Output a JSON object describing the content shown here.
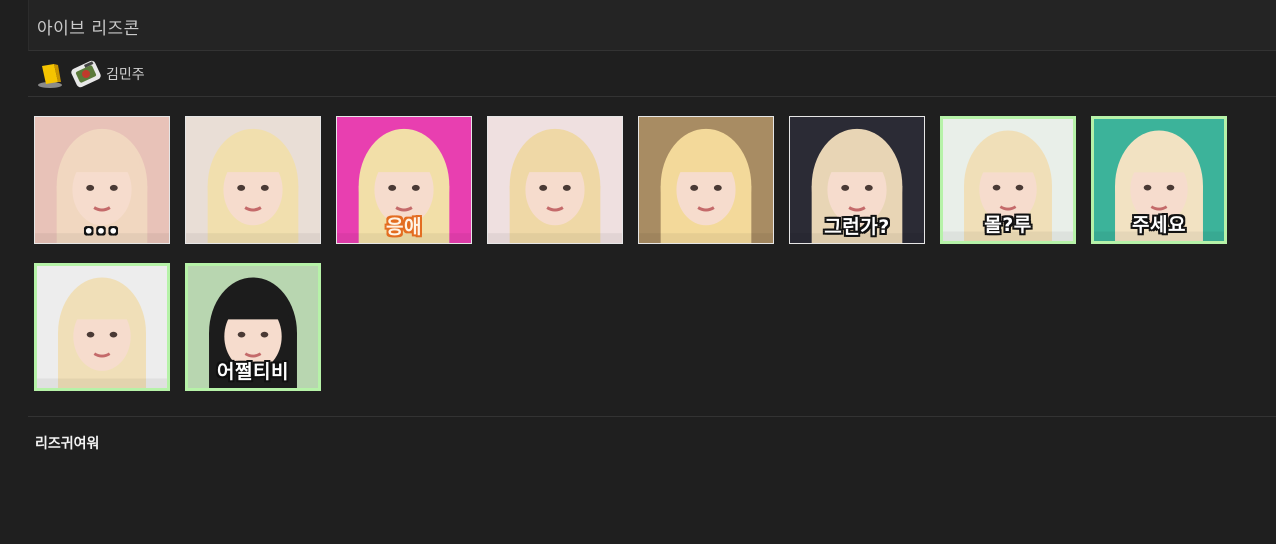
{
  "title": "아이브 리즈콘",
  "author": {
    "name": "김민주",
    "badge_icon": "yellow-trophy-icon",
    "avatar_icon": "tank-avatar-icon"
  },
  "emoticons": [
    {
      "caption": "•••",
      "style": "dots",
      "frame": "plain",
      "bg": "#e8c2b8",
      "hair": "#f1d7c0"
    },
    {
      "caption": "",
      "style": "",
      "frame": "plain",
      "bg": "#e9ded6",
      "hair": "#f1dfae"
    },
    {
      "caption": "응애",
      "style": "orange",
      "frame": "plain",
      "bg": "#e83fb0",
      "hair": "#f2dfa8"
    },
    {
      "caption": "",
      "style": "",
      "frame": "plain",
      "bg": "#efe0e0",
      "hair": "#efd8a6"
    },
    {
      "caption": "",
      "style": "",
      "frame": "plain",
      "bg": "#a88c63",
      "hair": "#f3d99a"
    },
    {
      "caption": "그런가?",
      "style": "",
      "frame": "plain",
      "bg": "#2b2b35",
      "hair": "#e8d5b5"
    },
    {
      "caption": "몰?루",
      "style": "",
      "frame": "green",
      "bg": "#e9efe9",
      "hair": "#f0dfb8"
    },
    {
      "caption": "주세요",
      "style": "",
      "frame": "green",
      "bg": "#3cb39a",
      "hair": "#f2e2c2"
    },
    {
      "caption": "",
      "style": "",
      "frame": "green",
      "bg": "#ededed",
      "hair": "#f0dfb8"
    },
    {
      "caption": "어쩔티비",
      "style": "",
      "frame": "green",
      "bg": "#b8d6b0",
      "hair": "#1c1c1c"
    }
  ],
  "description": "리즈귀여워",
  "colors": {
    "background": "#1f1f1f",
    "header": "#242424",
    "green_frame": "#b6f2a8"
  }
}
